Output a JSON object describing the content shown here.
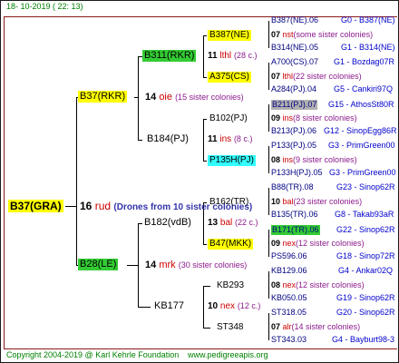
{
  "header": {
    "date": "18- 10-2019 ( 22: 13)"
  },
  "footer": {
    "copyright": "Copyright 2004-2019 @ Karl Kehrle Foundation",
    "site": "www.pedigreeapis.org"
  },
  "root": {
    "id": "B37(GRA)",
    "number": "16",
    "breed": "rud",
    "note": "(Drones from 10 sister colonies)"
  },
  "gen1": [
    {
      "id": "B37(RKR)",
      "number": "14",
      "breed": "oie",
      "note": "(15 sister colonies)"
    },
    {
      "id": "B28(LE)",
      "number": "14",
      "breed": "mrk",
      "note": "(30 sister colonies)"
    }
  ],
  "gen2": [
    {
      "id": "B311(RKR)",
      "number": "11",
      "breed": "lthl",
      "note": "(28 c.)"
    },
    {
      "id": "B184(PJ)",
      "number": "11",
      "breed": "ins",
      "note": "(8 c.)"
    },
    {
      "id": "B182(vdB)",
      "number": "13",
      "breed": "bal",
      "note": "(22 c.)"
    },
    {
      "id": "KB177",
      "number": "10",
      "breed": "nex",
      "note": "(12 c.)"
    }
  ],
  "gen3": [
    {
      "id": "B387(NE)",
      "number": "07",
      "breed": "nst",
      "note": "(some sister colonies)"
    },
    {
      "id": "A375(CS)",
      "number": "07",
      "breed": "lthl",
      "note": "(22 sister colonies)"
    },
    {
      "id": "B102(PJ)",
      "number": "09",
      "breed": "ins",
      "note": "(8 sister colonies)"
    },
    {
      "id": "P135H(PJ)",
      "number": "08",
      "breed": "ins",
      "note": "(9 sister colonies)"
    },
    {
      "id": "B162(TR)",
      "number": "10",
      "breed": "bal",
      "note": "(23 sister colonies)"
    },
    {
      "id": "B47(MKK)",
      "number": "09",
      "breed": "nex",
      "note": "(12 sister colonies)"
    },
    {
      "id": "KB293",
      "number": "08",
      "breed": "nex",
      "note": "(12 sister colonies)"
    },
    {
      "id": "ST348",
      "number": "07",
      "breed": "alr",
      "note": "(14 sister colonies)"
    }
  ],
  "gen4": [
    {
      "id": "B387(NE).06",
      "tag": "G0 - B387(NE)"
    },
    {
      "id": "B314(NE).05",
      "tag": "G1 - B314(NE)"
    },
    {
      "id": "A700(CS).07",
      "tag": "G1 - Bozdag07R"
    },
    {
      "id": "A284(PJ).04",
      "tag": "G5 - Cankiri97Q"
    },
    {
      "id": "B211(PJ).07",
      "tag": "G15 - AthosSt80R"
    },
    {
      "id": "B213(PJ).06",
      "tag": "G12 - SinopEgg86R"
    },
    {
      "id": "P133(PJ).05",
      "tag": "G3 - PrimGreen00"
    },
    {
      "id": "P133H(PJ).05",
      "tag": "G3 - PrimGreen00"
    },
    {
      "id": "B88(TR).08",
      "tag": "G23 - Sinop62R"
    },
    {
      "id": "B135(TR).06",
      "tag": "G8 - Takab93aR"
    },
    {
      "id": "B171(TR).06",
      "tag": "G22 - Sinop62R"
    },
    {
      "id": "PS596.06",
      "tag": "G18 - Sinop72R"
    },
    {
      "id": "KB129.06",
      "tag": "G4 - Ankar02Q"
    },
    {
      "id": "KB050.05",
      "tag": "G19 - Sinop62R"
    },
    {
      "id": "ST318.05",
      "tag": "G20 - Sinop62R"
    },
    {
      "id": "ST343.03",
      "tag": "G4 - Bayburt98-3"
    }
  ],
  "colors": {
    "yellow": "#ffff00",
    "green": "#33cc33",
    "cyan": "#33ffff",
    "gray": "#b0b0b0",
    "red": "#cc0000",
    "navy": "#000080"
  }
}
